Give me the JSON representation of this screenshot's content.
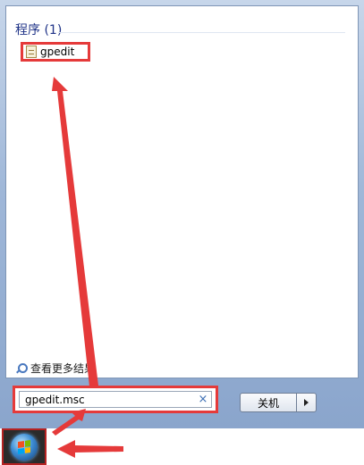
{
  "results": {
    "section_header": "程序 (1)",
    "items": [
      {
        "label": "gpedit",
        "icon": "document-icon"
      }
    ],
    "see_more_label": "查看更多结果"
  },
  "search": {
    "value": "gpedit.msc",
    "clear_glyph": "×"
  },
  "shutdown": {
    "label": "关机"
  },
  "colors": {
    "highlight_red": "#e53a3a",
    "header_blue": "#1e3287"
  }
}
